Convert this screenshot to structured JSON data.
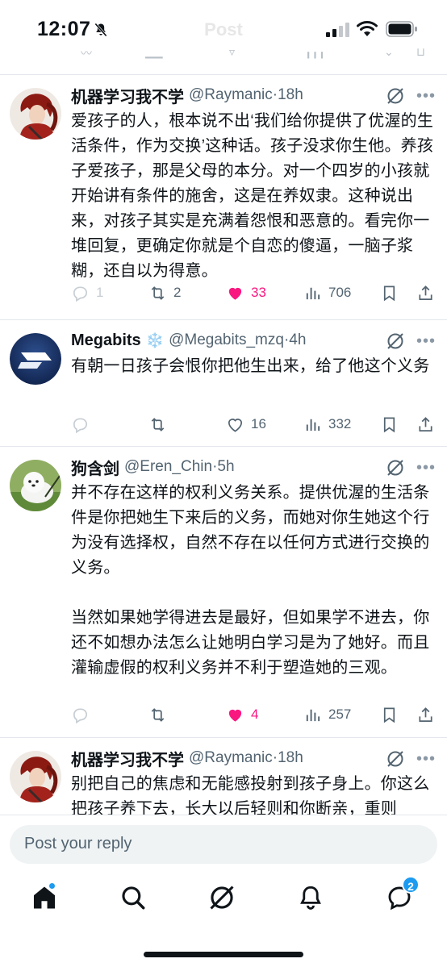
{
  "status_bar": {
    "time": "12:07",
    "ghost_title": "Post",
    "icons": [
      "bell-slash-icon",
      "cellular-signal-icon",
      "wifi-icon",
      "battery-icon"
    ]
  },
  "tweets": [
    {
      "name": "机器学习我不学",
      "handle": "@Raymanic",
      "time": "·18h",
      "text": "爱孩子的人，根本说不出‘我们给你提供了优渥的生活条件，作为交换’这种话。孩子没求你生他。养孩子爱孩子，那是父母的本分。对一个四岁的小孩就开始讲有条件的施舍，这是在养奴隶。这种说出来，对孩子其实是充满着怨恨和恶意的。看完你一堆回复，更确定你就是个自恋的傻逼，一脑子浆糊，还自以为得意。",
      "replies": "1",
      "reposts": "2",
      "likes": "33",
      "liked": true,
      "views": "706"
    },
    {
      "name": "Megabits",
      "emoji": "❄️",
      "handle": "@Megabits_mzq",
      "time": "·4h",
      "text": "有朝一日孩子会恨你把他生出来，给了他这个义务",
      "replies": "",
      "reposts": "",
      "likes": "16",
      "liked": false,
      "views": "332"
    },
    {
      "name": "狗含剑",
      "handle": "@Eren_Chin",
      "time": "·5h",
      "text": "并不存在这样的权利义务关系。提供优渥的生活条件是你把她生下来后的义务，而她对你生她这个行为没有选择权，自然不存在以任何方式进行交换的义务。\n\n当然如果她学得进去是最好，但如果学不进去，你还不如想办法怎么让她明白学习是为了她好。而且灌输虚假的权利义务并不利于塑造她的三观。",
      "replies": "",
      "reposts": "",
      "likes": "4",
      "liked": true,
      "views": "257"
    },
    {
      "name": "机器学习我不学",
      "handle": "@Raymanic",
      "time": "·18h",
      "text": "别把自己的焦虑和无能感投射到孩子身上。你这么把孩子养下去，长大以后轻则和你断亲，重则"
    }
  ],
  "reply_box": {
    "placeholder": "Post your reply"
  },
  "tab_bar": {
    "items": [
      "home-icon",
      "search-icon",
      "grok-icon",
      "notifications-icon",
      "messages-icon"
    ],
    "messages_badge": "2"
  },
  "colors": {
    "like": "#f91880",
    "accent": "#1d9bf0",
    "muted": "#536471"
  }
}
